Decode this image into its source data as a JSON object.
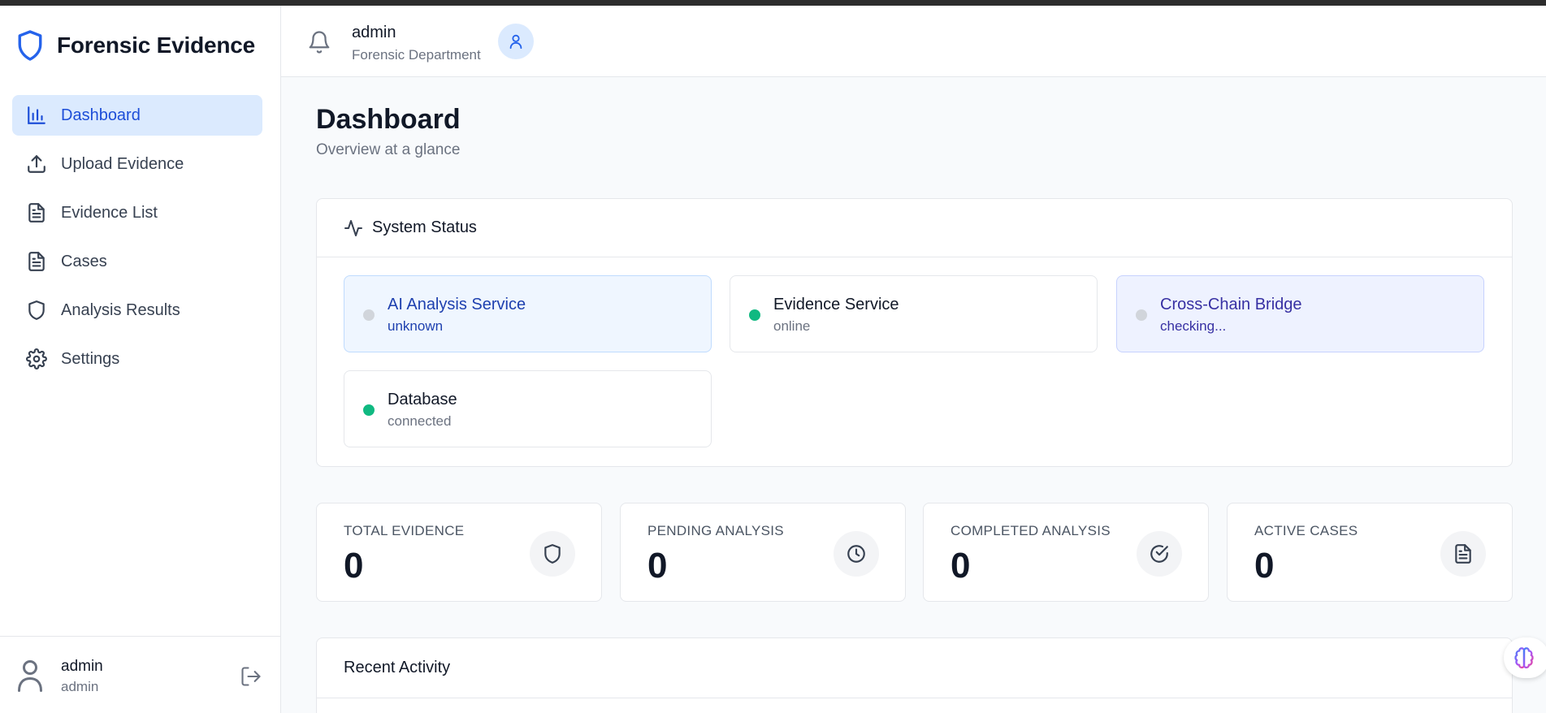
{
  "app": {
    "title": "Forensic Evidence"
  },
  "sidebar": {
    "items": [
      {
        "label": "Dashboard",
        "icon": "bar-chart-icon",
        "active": true
      },
      {
        "label": "Upload Evidence",
        "icon": "upload-icon"
      },
      {
        "label": "Evidence List",
        "icon": "document-icon"
      },
      {
        "label": "Cases",
        "icon": "document-icon"
      },
      {
        "label": "Analysis Results",
        "icon": "shield-icon"
      },
      {
        "label": "Settings",
        "icon": "gear-icon"
      }
    ],
    "user": {
      "name": "admin",
      "role": "admin"
    }
  },
  "header": {
    "user_name": "admin",
    "department": "Forensic Department"
  },
  "page": {
    "title": "Dashboard",
    "subtitle": "Overview at a glance"
  },
  "system_status": {
    "title": "System Status",
    "services": [
      {
        "name": "AI Analysis Service",
        "status": "unknown",
        "indicator": "gray"
      },
      {
        "name": "Evidence Service",
        "status": "online",
        "indicator": "green"
      },
      {
        "name": "Cross-Chain Bridge",
        "status": "checking...",
        "indicator": "gray"
      },
      {
        "name": "Database",
        "status": "connected",
        "indicator": "green"
      }
    ]
  },
  "stats": [
    {
      "label": "TOTAL EVIDENCE",
      "value": "0",
      "icon": "shield-icon"
    },
    {
      "label": "PENDING ANALYSIS",
      "value": "0",
      "icon": "clock-icon"
    },
    {
      "label": "COMPLETED ANALYSIS",
      "value": "0",
      "icon": "check-circle-icon"
    },
    {
      "label": "ACTIVE CASES",
      "value": "0",
      "icon": "document-icon"
    }
  ],
  "recent_activity": {
    "title": "Recent Activity"
  },
  "colors": {
    "accent": "#1d4ed8",
    "active_bg": "#dbeafe",
    "online": "#10b981",
    "unknown": "#d1d5db"
  }
}
